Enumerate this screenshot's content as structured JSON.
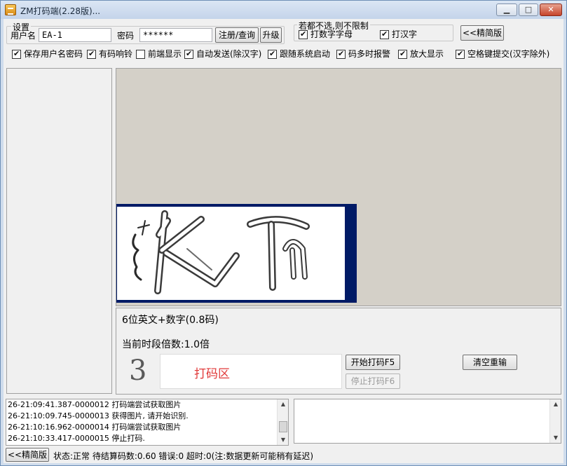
{
  "window": {
    "title": "ZM打码端(2.28版)...",
    "controls": {
      "minimize": "▁",
      "maximize": "□",
      "close": "✕"
    }
  },
  "settings": {
    "group_label": "设置",
    "username_label": "用户名",
    "username_value": "EA-1",
    "password_label": "密码",
    "password_value": "******",
    "register_button": "注册/查询",
    "upgrade_button": "升级"
  },
  "filter": {
    "group_label": "若都不选,则不限制",
    "letters_label": "打数字字母",
    "letters_checked": true,
    "hanzi_label": "打汉字",
    "hanzi_checked": true,
    "compact_button": "<<精简版"
  },
  "options": [
    {
      "label": "保存用户名密码",
      "checked": true
    },
    {
      "label": "有码响铃",
      "checked": true
    },
    {
      "label": "前端显示",
      "checked": false
    },
    {
      "label": "自动发送(除汉字)",
      "checked": true
    },
    {
      "label": "跟随系统启动",
      "checked": true
    },
    {
      "label": "码多时报警",
      "checked": true
    },
    {
      "label": "放大显示",
      "checked": true
    },
    {
      "label": "空格键提交(汉字除外)",
      "checked": true
    }
  ],
  "task": {
    "type_text": "6位英文+数字(0.8码)",
    "multiplier_text": "当前时段倍数:1.0倍",
    "countdown": "3",
    "input_placeholder": "打码区",
    "start_button": "开始打码F5",
    "stop_button": "停止打码F6",
    "clear_button": "清空重输"
  },
  "log": [
    "26-21:09:41.387-0000012 打码端尝试获取图片",
    "26-21:10:09.745-0000013 获得图片, 请开始识别.",
    "26-21:10:16.962-0000014 打码端尝试获取图片",
    "26-21:10:33.417-0000015 停止打码."
  ],
  "status": {
    "compact_button": "<<精简版",
    "text": "状态:正常 待结算码数:0.60 错误:0 超时:0(注:数据更新可能稍有延迟)"
  },
  "colors": {
    "accent_red": "#e03a3a",
    "captcha_border": "#001a66"
  }
}
